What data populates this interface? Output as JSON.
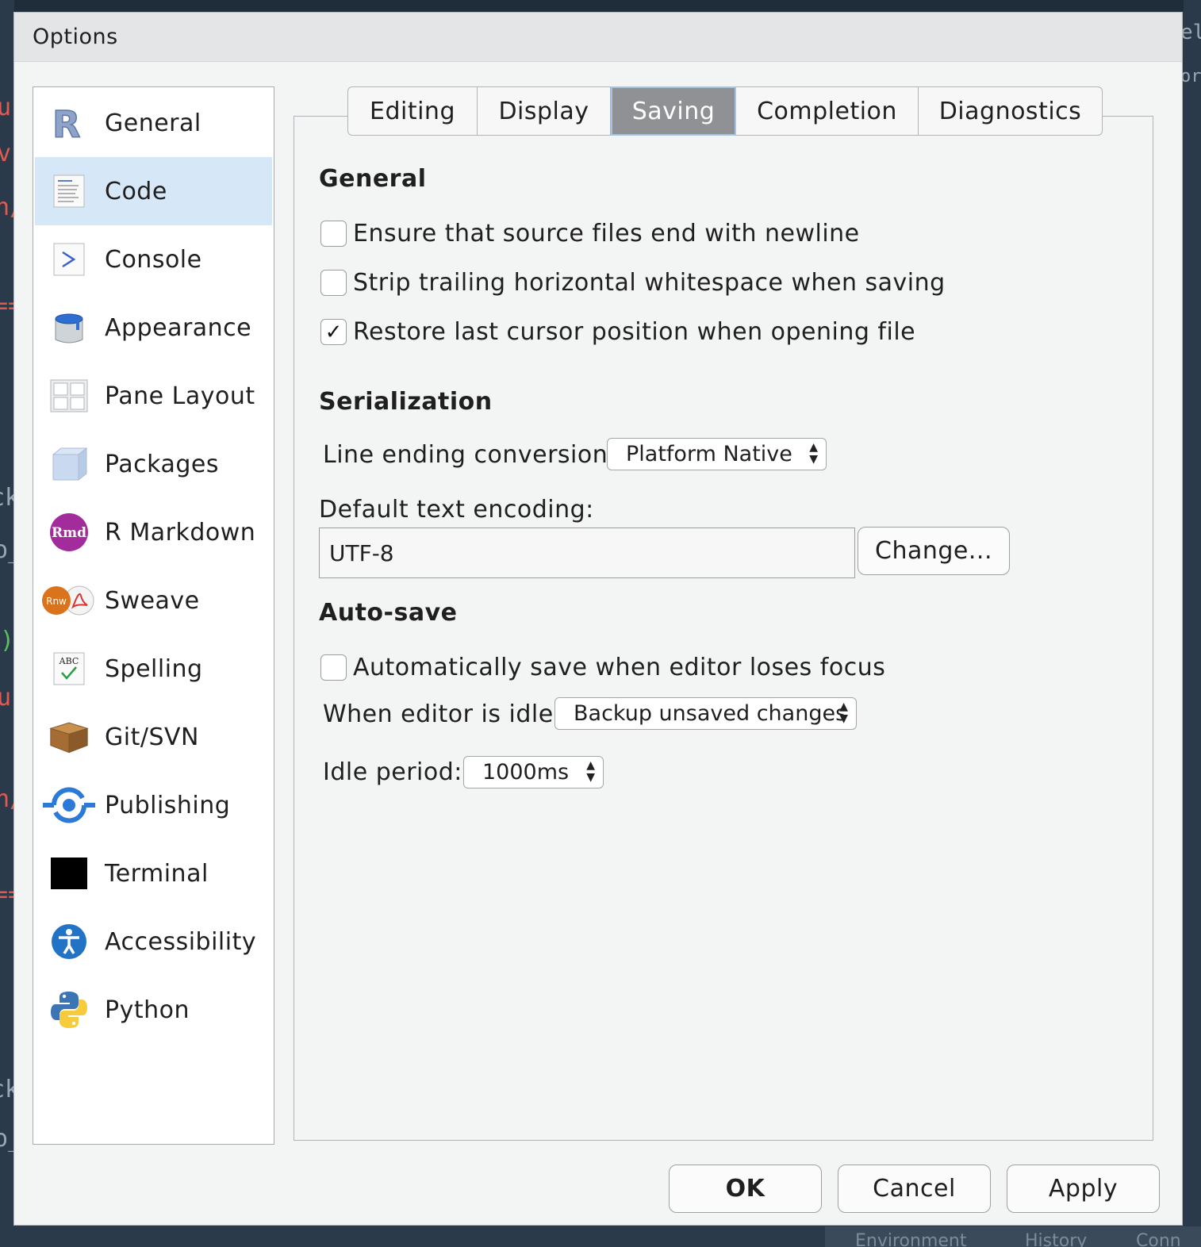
{
  "window": {
    "title": "Options"
  },
  "background": {
    "fragments": [
      "u",
      "v",
      "n/",
      "==",
      "ck",
      "o_",
      ")",
      "u",
      "n/",
      "==",
      "ck",
      "o_"
    ],
    "right_fragments": [
      "el",
      "or"
    ],
    "bottom_tabs": [
      "Environment",
      "History",
      "Conn"
    ]
  },
  "sidebar": {
    "items": [
      {
        "label": "General",
        "icon": "r-logo-icon"
      },
      {
        "label": "Code",
        "icon": "code-document-icon"
      },
      {
        "label": "Console",
        "icon": "console-prompt-icon"
      },
      {
        "label": "Appearance",
        "icon": "paint-bucket-icon"
      },
      {
        "label": "Pane Layout",
        "icon": "pane-grid-icon"
      },
      {
        "label": "Packages",
        "icon": "package-box-icon"
      },
      {
        "label": "R Markdown",
        "icon": "rmd-icon"
      },
      {
        "label": "Sweave",
        "icon": "sweave-pdf-icon"
      },
      {
        "label": "Spelling",
        "icon": "spelling-check-icon"
      },
      {
        "label": "Git/SVN",
        "icon": "git-box-icon"
      },
      {
        "label": "Publishing",
        "icon": "publishing-icon"
      },
      {
        "label": "Terminal",
        "icon": "terminal-icon"
      },
      {
        "label": "Accessibility",
        "icon": "accessibility-icon"
      },
      {
        "label": "Python",
        "icon": "python-icon"
      }
    ],
    "active_index": 1
  },
  "tabs": [
    {
      "label": "Editing"
    },
    {
      "label": "Display"
    },
    {
      "label": "Saving"
    },
    {
      "label": "Completion"
    },
    {
      "label": "Diagnostics"
    }
  ],
  "active_tab": "Saving",
  "general": {
    "heading": "General",
    "options": [
      {
        "label": "Ensure that source files end with newline",
        "checked": false
      },
      {
        "label": "Strip trailing horizontal whitespace when saving",
        "checked": false
      },
      {
        "label": "Restore last cursor position when opening file",
        "checked": true
      }
    ]
  },
  "serialization": {
    "heading": "Serialization",
    "line_ending_label": "Line ending conversion:",
    "line_ending_value": "Platform Native",
    "encoding_label": "Default text encoding:",
    "encoding_value": "UTF-8",
    "change_button": "Change..."
  },
  "autosave": {
    "heading": "Auto-save",
    "lose_focus_label": "Automatically save when editor loses focus",
    "lose_focus_checked": false,
    "idle_label": "When editor is idle:",
    "idle_value": "Backup unsaved changes",
    "period_label": "Idle period:",
    "period_value": "1000ms"
  },
  "buttons": {
    "ok": "OK",
    "cancel": "Cancel",
    "apply": "Apply"
  },
  "colors": {
    "active_item": "#d6e7f7",
    "active_tab": "#8f9194",
    "dialog_bg": "#f3f4f4"
  }
}
